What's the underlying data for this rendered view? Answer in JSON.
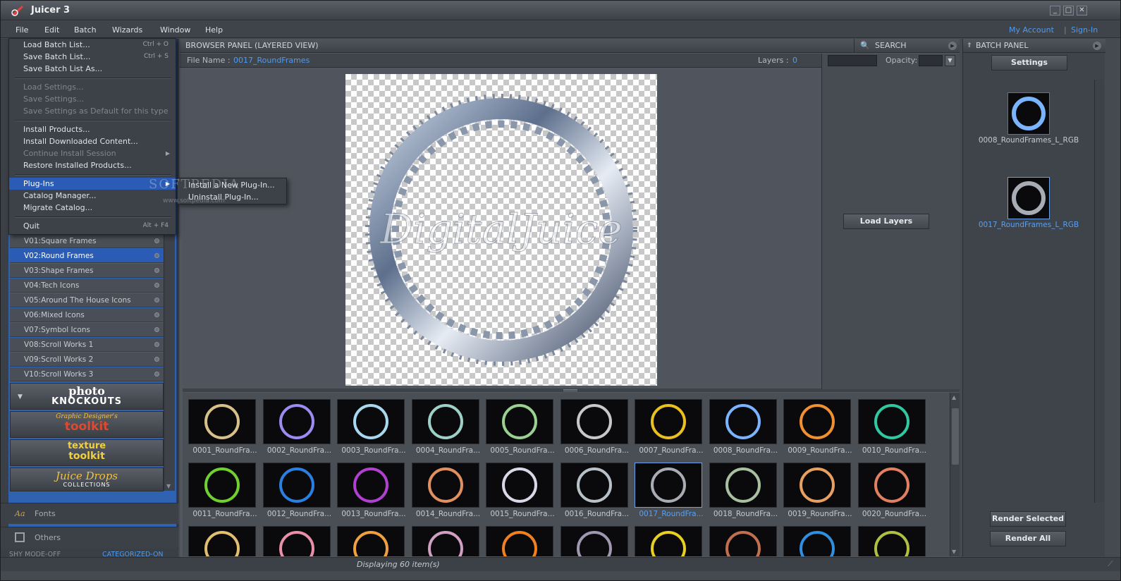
{
  "app": {
    "title": "Juicer 3"
  },
  "window_buttons": {
    "minimize": "_",
    "maximize": "□",
    "close": "✕"
  },
  "menubar": {
    "items": [
      "File",
      "Edit",
      "Batch",
      "Wizards",
      "Window",
      "Help"
    ],
    "account": "My Account",
    "separator": "|",
    "signin": "Sign-In"
  },
  "file_menu": {
    "items": [
      {
        "label": "Load Batch List...",
        "shortcut": "Ctrl + O",
        "disabled": false
      },
      {
        "label": "Save Batch List...",
        "shortcut": "Ctrl + S",
        "disabled": false
      },
      {
        "label": "Save Batch List As...",
        "shortcut": "",
        "disabled": false
      },
      {
        "label": "Load Settings...",
        "shortcut": "",
        "disabled": true
      },
      {
        "label": "Save Settings...",
        "shortcut": "",
        "disabled": true
      },
      {
        "label": "Save Settings as Default for this type",
        "shortcut": "",
        "disabled": true
      },
      {
        "label": "Install Products...",
        "shortcut": "",
        "disabled": false
      },
      {
        "label": "Install Downloaded Content...",
        "shortcut": "",
        "disabled": false
      },
      {
        "label": "Continue Install Session",
        "shortcut": "",
        "disabled": true
      },
      {
        "label": "Restore Installed Products...",
        "shortcut": "",
        "disabled": false
      },
      {
        "label": "Plug-Ins",
        "shortcut": "",
        "disabled": false
      },
      {
        "label": "Catalog Manager...",
        "shortcut": "",
        "disabled": false
      },
      {
        "label": "Migrate Catalog...",
        "shortcut": "",
        "disabled": false
      },
      {
        "label": "Quit",
        "shortcut": "Alt + F4",
        "disabled": false
      }
    ]
  },
  "plugins_submenu": {
    "items": [
      "Install a New Plug-In...",
      "Uninstall Plug-In..."
    ]
  },
  "watermark": {
    "text": "SOFTPEDIA",
    "url": "www.softpedia.com"
  },
  "categories": [
    {
      "label": "V01:Square Frames",
      "selected": false
    },
    {
      "label": "V02:Round Frames",
      "selected": true
    },
    {
      "label": "V03:Shape Frames",
      "selected": false
    },
    {
      "label": "V04:Tech Icons",
      "selected": false
    },
    {
      "label": "V05:Around The House Icons",
      "selected": false
    },
    {
      "label": "V06:Mixed Icons",
      "selected": false
    },
    {
      "label": "V07:Symbol Icons",
      "selected": false
    },
    {
      "label": "V08:Scroll Works 1",
      "selected": false
    },
    {
      "label": "V09:Scroll Works 2",
      "selected": false
    },
    {
      "label": "V10:Scroll Works 3",
      "selected": false
    }
  ],
  "product_brands": [
    {
      "line1": "photo",
      "line2": "KNOCKOUTS"
    },
    {
      "line1": "Graphic Designer's",
      "line2": "toolkit"
    },
    {
      "line1": "texture",
      "line2": "toolkit"
    },
    {
      "line1": "Juice Drops",
      "line2": "COLLECTIONS"
    }
  ],
  "left_tabs": {
    "fonts": "Fonts",
    "others": "Others"
  },
  "left_status": {
    "shy_mode": "SHY MODE-OFF",
    "categorized": "CATEGORIZED-ON"
  },
  "browser": {
    "header": "BROWSER PANEL (LAYERED VIEW)",
    "search_label": "SEARCH",
    "file_name_label": "File Name :",
    "file_name_value": "0017_RoundFrames",
    "layers_label": "Layers :",
    "layers_value": "0",
    "opacity_label": "Opacity:",
    "preview_watermark": "DigitalJuice",
    "load_layers_button": "Load Layers",
    "status": "Displaying 60 item(s)"
  },
  "thumbnails": [
    {
      "label": "0001_RoundFra...",
      "color": "#d8c08a",
      "selected": false
    },
    {
      "label": "0002_RoundFra...",
      "color": "#9a8cf0",
      "selected": false
    },
    {
      "label": "0003_RoundFra...",
      "color": "#a8d8f0",
      "selected": false
    },
    {
      "label": "0004_RoundFra...",
      "color": "#9ed0c8",
      "selected": false
    },
    {
      "label": "0005_RoundFra...",
      "color": "#9ad090",
      "selected": false
    },
    {
      "label": "0006_RoundFra...",
      "color": "#c8c8c8",
      "selected": false
    },
    {
      "label": "0007_RoundFra...",
      "color": "#e8c020",
      "selected": false
    },
    {
      "label": "0008_RoundFra...",
      "color": "#7ab4ff",
      "selected": false
    },
    {
      "label": "0009_RoundFra...",
      "color": "#f09030",
      "selected": false
    },
    {
      "label": "0010_RoundFra...",
      "color": "#30c8a0",
      "selected": false
    },
    {
      "label": "0011_RoundFra...",
      "color": "#70d030",
      "selected": false
    },
    {
      "label": "0012_RoundFra...",
      "color": "#2a80e0",
      "selected": false
    },
    {
      "label": "0013_RoundFra...",
      "color": "#b040d0",
      "selected": false
    },
    {
      "label": "0014_RoundFra...",
      "color": "#e09060",
      "selected": false
    },
    {
      "label": "0015_RoundFra...",
      "color": "#d8d8e8",
      "selected": false
    },
    {
      "label": "0016_RoundFra...",
      "color": "#b8c0c8",
      "selected": false
    },
    {
      "label": "0017_RoundFra...",
      "color": "#a8acb4",
      "selected": true
    },
    {
      "label": "0018_RoundFra...",
      "color": "#a8c0a0",
      "selected": false
    },
    {
      "label": "0019_RoundFra...",
      "color": "#e8a060",
      "selected": false
    },
    {
      "label": "0020_RoundFra...",
      "color": "#e08060",
      "selected": false
    },
    {
      "label": "",
      "color": "#e0c070",
      "selected": false
    },
    {
      "label": "",
      "color": "#e890a8",
      "selected": false
    },
    {
      "label": "",
      "color": "#f0a040",
      "selected": false
    },
    {
      "label": "",
      "color": "#d0a0c0",
      "selected": false
    },
    {
      "label": "",
      "color": "#f08020",
      "selected": false
    },
    {
      "label": "",
      "color": "#a098b0",
      "selected": false
    },
    {
      "label": "",
      "color": "#e8d020",
      "selected": false
    },
    {
      "label": "",
      "color": "#c07050",
      "selected": false
    },
    {
      "label": "",
      "color": "#3090e0",
      "selected": false
    },
    {
      "label": "",
      "color": "#b0c040",
      "selected": false
    }
  ],
  "batch": {
    "header": "BATCH PANEL",
    "settings_button": "Settings",
    "items": [
      {
        "label": "0008_RoundFrames_L_RGB",
        "color": "#7ab4ff",
        "selected": false
      },
      {
        "label": "0017_RoundFrames_L_RGB",
        "color": "#a8acb4",
        "selected": true
      }
    ],
    "render_selected": "Render Selected",
    "render_all": "Render All"
  }
}
